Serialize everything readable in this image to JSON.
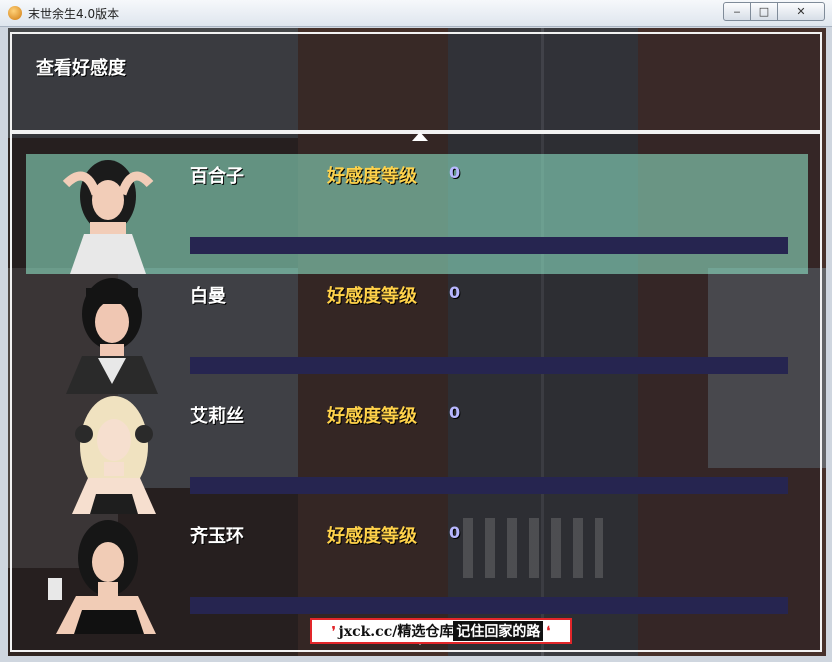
{
  "window": {
    "title": "末世余生4.0版本",
    "min_glyph": "‒",
    "max_glyph": "□",
    "close_glyph": "✕"
  },
  "header": {
    "title": "查看好感度"
  },
  "characters": [
    {
      "name": "百合子",
      "level_label": "好感度等级",
      "level": "0",
      "hair": "#1b1b1b",
      "outfit": "#e8e8e8",
      "skin": "#f2cdb8"
    },
    {
      "name": "白曼",
      "level_label": "好感度等级",
      "level": "0",
      "hair": "#141414",
      "outfit": "#2a2a2a",
      "skin": "#f0c7b3"
    },
    {
      "name": "艾莉丝",
      "level_label": "好感度等级",
      "level": "0",
      "hair": "#f0e2c0",
      "outfit": "#1e1e1e",
      "skin": "#f6dfcf"
    },
    {
      "name": "齐玉环",
      "level_label": "好感度等级",
      "level": "0",
      "hair": "#161616",
      "outfit": "#111111",
      "skin": "#f1ccb6"
    }
  ],
  "watermark": {
    "site": "jxck.cc/精选仓库",
    "slogan": "记住回家的路"
  },
  "colors": {
    "bar": "#262550",
    "level_label": "#ffd24a",
    "selected_row": "#96f0d2"
  }
}
